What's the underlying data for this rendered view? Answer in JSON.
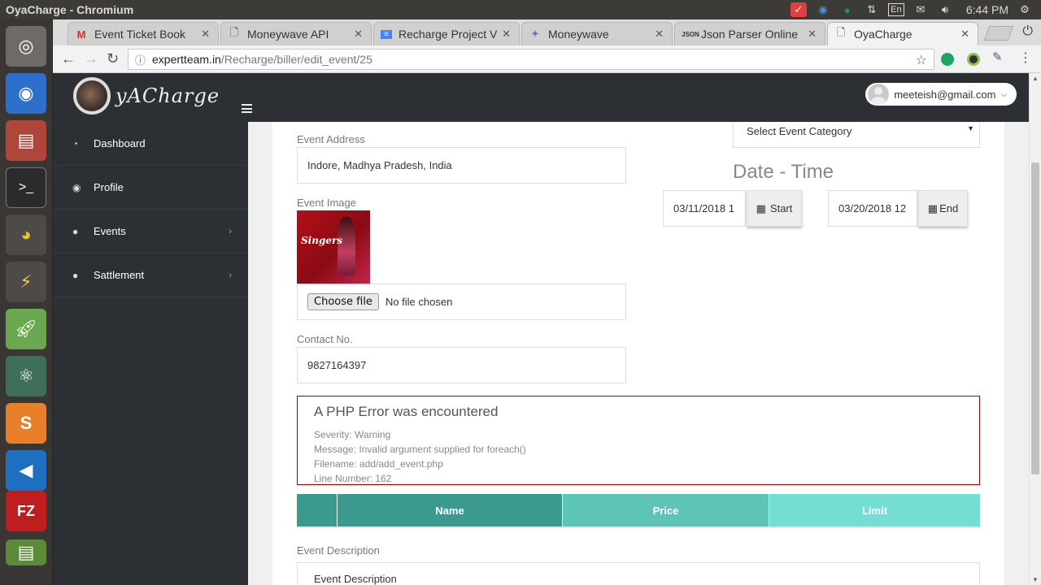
{
  "os": {
    "window_title": "OyaCharge - Chromium",
    "clock": "6:44 PM",
    "keyboard_lang": "En"
  },
  "browser": {
    "tabs": [
      {
        "label": "Event Ticket Book",
        "icon": "gmail-icon"
      },
      {
        "label": "Moneywave API",
        "icon": "page-icon"
      },
      {
        "label": "Recharge Project V",
        "icon": "docs-icon"
      },
      {
        "label": "Moneywave",
        "icon": "moneywave-icon"
      },
      {
        "label": "Json Parser Online",
        "icon": "json-icon"
      },
      {
        "label": "OyaCharge",
        "icon": "page-icon"
      }
    ],
    "url_host": "expertteam.in",
    "url_path": "/Recharge/biller/edit_event/25"
  },
  "header": {
    "logo_text": "yACharge",
    "user_email": "meeteish@gmail.com"
  },
  "sidebar": {
    "items": [
      {
        "label": "Dashboard",
        "icon": "dashboard-icon",
        "has_children": false
      },
      {
        "label": "Profile",
        "icon": "profile-icon",
        "has_children": false
      },
      {
        "label": "Events",
        "icon": "user-icon",
        "has_children": true
      },
      {
        "label": "Sattlement",
        "icon": "user-icon",
        "has_children": true
      }
    ]
  },
  "form": {
    "category_select": "Select Event Category",
    "address_label": "Event Address",
    "address_value": "Indore, Madhya Pradesh, India",
    "image_label": "Event Image",
    "image_caption": "Singers",
    "choose_file_label": "Choose file",
    "no_file_text": "No file chosen",
    "contact_label": "Contact No.",
    "contact_value": "9827164397",
    "datetime_title": "Date - Time",
    "start_value": "03/11/2018 1",
    "start_button": "Start",
    "end_value": "03/20/2018 12",
    "end_button": "End",
    "description_label": "Event Description",
    "description_placeholder": "Event Description"
  },
  "error": {
    "heading": "A PHP Error was encountered",
    "lines": [
      "Severity: Warning",
      "Message: Invalid argument supplied for foreach()",
      "Filename: add/add_event.php",
      "Line Number: 162"
    ]
  },
  "ticket_table": {
    "headers": [
      "",
      "Name",
      "Price",
      "Limit"
    ],
    "colors": [
      "#3a9a8e",
      "#3a9a8e",
      "#5ec4b6",
      "#74ddd4"
    ]
  },
  "colors": {
    "sidebar_bg": "#2c2f34",
    "error_border": "#990000"
  }
}
